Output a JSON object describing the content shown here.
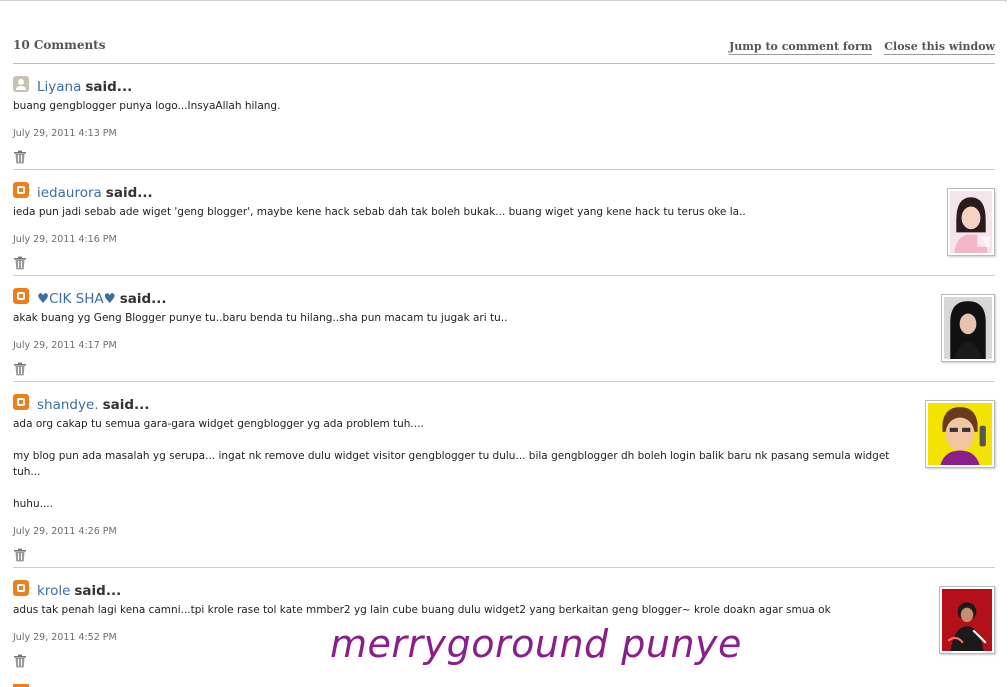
{
  "header": {
    "comment_count": "10 Comments",
    "jump_link": "Jump to comment form",
    "close_link": "Close this window"
  },
  "colors": {
    "link": "#3b6ea5",
    "blogger_orange": "#f07e1e",
    "watermark": "#8a1f8c"
  },
  "comments": [
    {
      "icon": "user-icon",
      "author": "Liyana",
      "said": "said...",
      "body": "buang gengblogger punya logo...InsyaAllah hilang.",
      "timestamp": "July 29, 2011 4:13 PM"
    },
    {
      "icon": "blogger-icon",
      "author": "iedaurora",
      "said": "said...",
      "body": "ieda pun jadi sebab ade wiget 'geng blogger', maybe kene hack sebab dah tak boleh bukak... buang wiget yang kene hack tu terus oke la..",
      "timestamp": "July 29, 2011 4:16 PM"
    },
    {
      "icon": "blogger-icon",
      "author": "♥CIK SHA♥",
      "said": "said...",
      "body": "akak buang yg Geng Blogger punye tu..baru benda tu hilang..sha pun macam tu jugak ari tu..",
      "timestamp": "July 29, 2011 4:17 PM"
    },
    {
      "icon": "blogger-icon",
      "author": "shandye.",
      "said": "said...",
      "body_lines": [
        "ada org cakap tu semua gara-gara widget gengblogger yg ada problem tuh....",
        "my blog pun ada masalah yg serupa... ingat nk remove dulu widget visitor gengblogger tu dulu... bila gengblogger dh boleh login balik baru nk pasang semula widget tuh...",
        "huhu...."
      ],
      "timestamp": "July 29, 2011 4:26 PM"
    },
    {
      "icon": "blogger-icon",
      "author": "krole",
      "said": "said...",
      "body": "adus tak penah lagi kena camni...tpi krole rase tol kate mmber2 yg lain cube buang dulu widget2 yang berkaitan geng blogger~ krole doakn agar smua ok",
      "timestamp": "July 29, 2011 4:52 PM"
    }
  ],
  "watermark": "merrygoround punye"
}
